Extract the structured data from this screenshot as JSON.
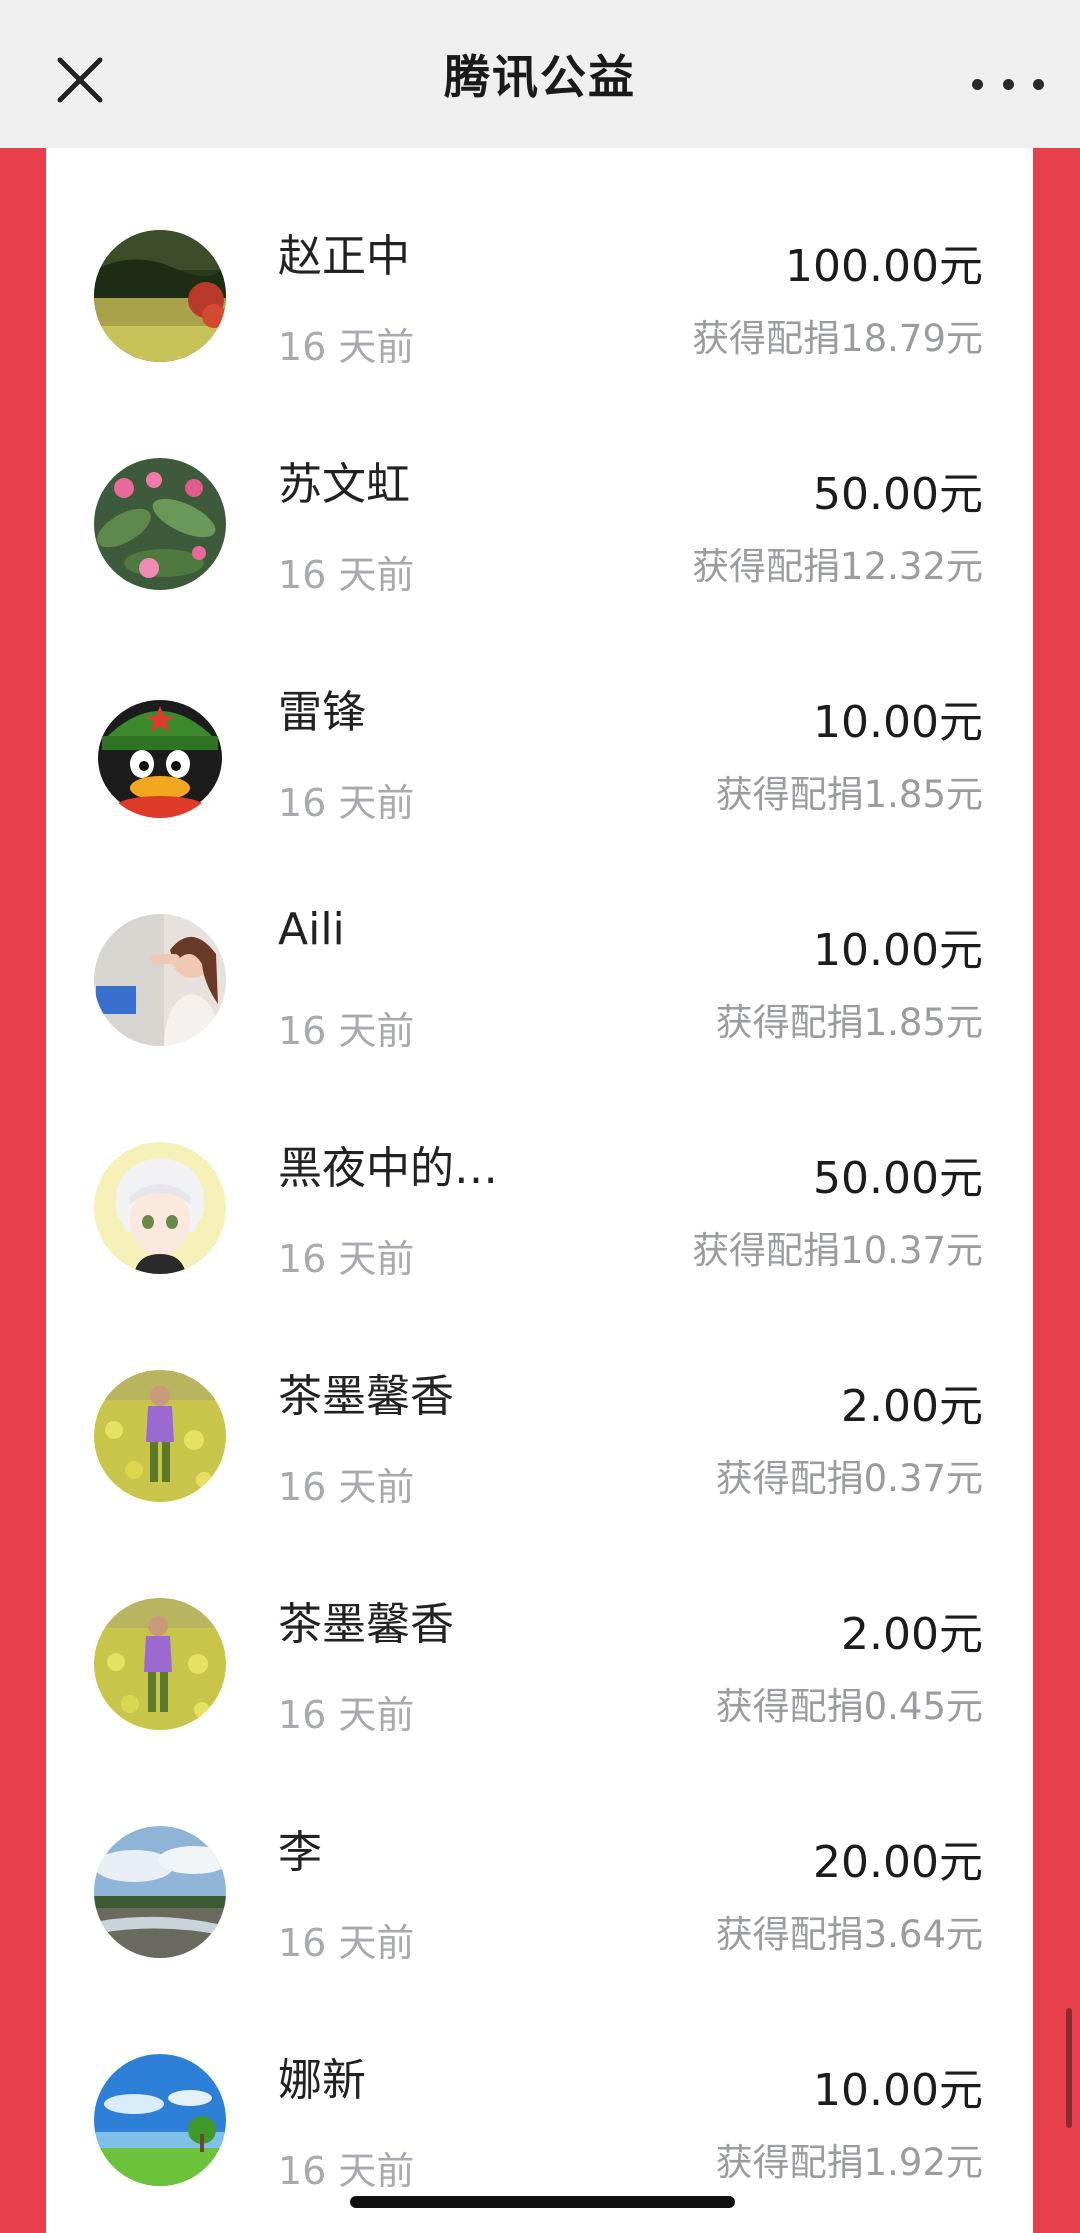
{
  "header": {
    "title": "腾讯公益",
    "close_icon": "close-icon",
    "more_icon": "more-icon"
  },
  "colors": {
    "background": "#e8404a",
    "panel": "#ffffff",
    "header": "#efefef",
    "secondary_text": "#a8aab0"
  },
  "donations": [
    {
      "name": "赵正中",
      "time": "16 天前",
      "amount": "100.00元",
      "match": "获得配捐18.79元",
      "avatar": "lake-landscape"
    },
    {
      "name": "苏文虹",
      "time": "16 天前",
      "amount": "50.00元",
      "match": "获得配捐12.32元",
      "avatar": "pink-flowers"
    },
    {
      "name": "雷锋",
      "time": "16 天前",
      "amount": "10.00元",
      "match": "获得配捐1.85元",
      "avatar": "penguin-soldier"
    },
    {
      "name": "Aili",
      "time": "16 天前",
      "amount": "10.00元",
      "match": "获得配捐1.85元",
      "avatar": "girl-selfie"
    },
    {
      "name": "黑夜中的…",
      "time": "16 天前",
      "amount": "50.00元",
      "match": "获得配捐10.37元",
      "avatar": "anime-boy"
    },
    {
      "name": "茶墨馨香",
      "time": "16 天前",
      "amount": "2.00元",
      "match": "获得配捐0.37元",
      "avatar": "rapeseed-field"
    },
    {
      "name": "茶墨馨香",
      "time": "16 天前",
      "amount": "2.00元",
      "match": "获得配捐0.45元",
      "avatar": "rapeseed-field"
    },
    {
      "name": "李",
      "time": "16 天前",
      "amount": "20.00元",
      "match": "获得配捐3.64元",
      "avatar": "river-sky"
    },
    {
      "name": "娜新",
      "time": "16 天前",
      "amount": "10.00元",
      "match": "获得配捐1.92元",
      "avatar": "blue-sky-meadow"
    }
  ]
}
